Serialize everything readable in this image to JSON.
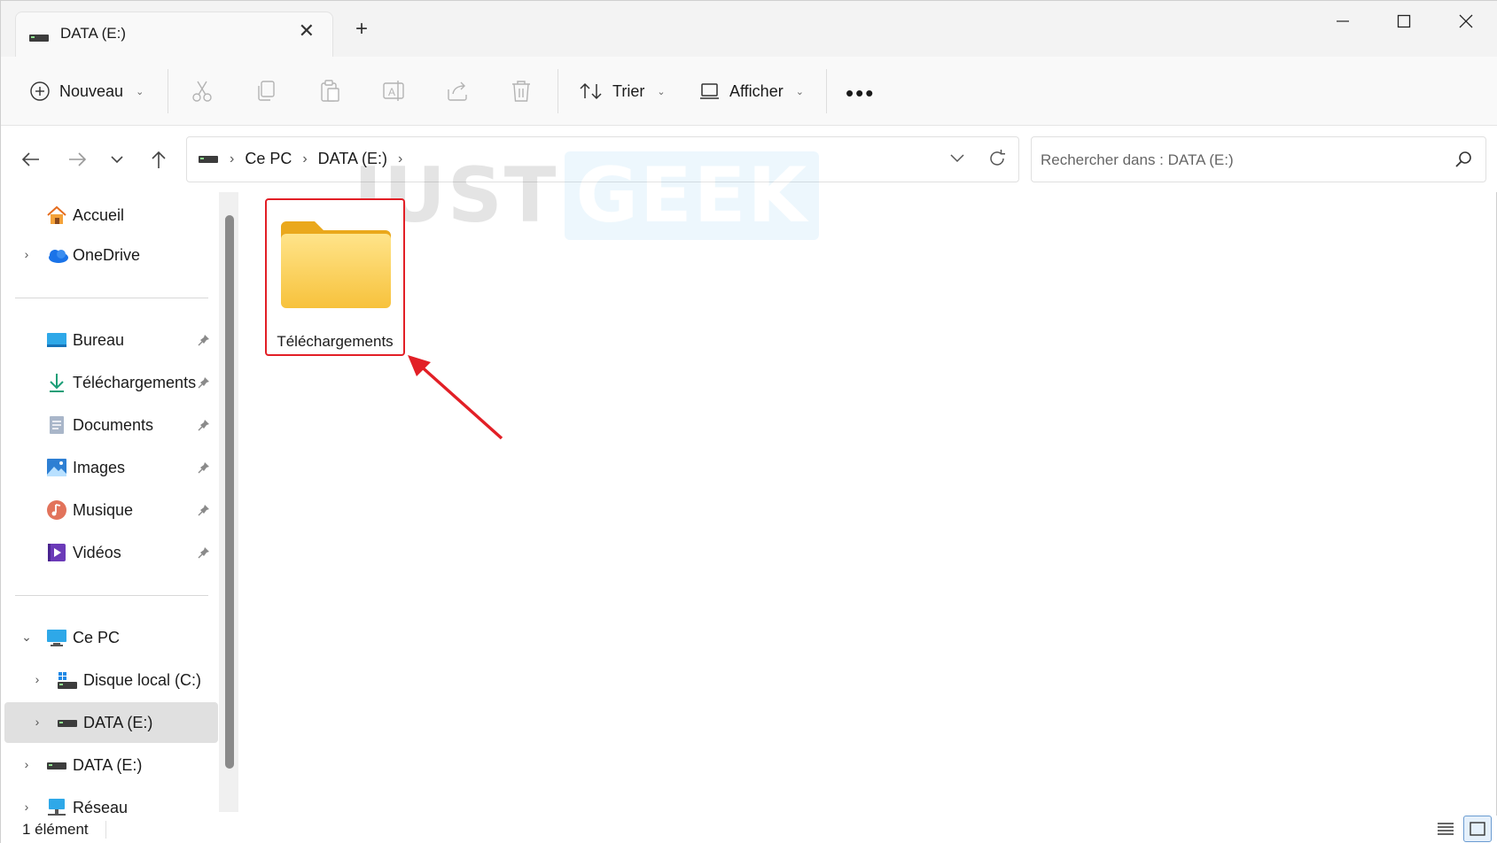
{
  "tab": {
    "title": "DATA (E:)",
    "close_glyph": "✕",
    "new_glyph": "+"
  },
  "window_controls": {
    "minimize": "minimize-icon",
    "maximize": "maximize-icon",
    "close": "close-icon"
  },
  "toolbar": {
    "new_label": "Nouveau",
    "sort_label": "Trier",
    "view_label": "Afficher",
    "more_label": "•••",
    "icons": [
      "cut-icon",
      "copy-icon",
      "paste-icon",
      "rename-icon",
      "share-icon",
      "delete-icon"
    ]
  },
  "address": {
    "crumbs": [
      "Ce PC",
      "DATA (E:)"
    ],
    "separator": "›"
  },
  "search": {
    "placeholder": "Rechercher dans : DATA (E:)"
  },
  "sidebar": {
    "quick": [
      {
        "label": "Accueil",
        "icon": "home-icon"
      },
      {
        "label": "OneDrive",
        "icon": "onedrive-icon"
      }
    ],
    "pinned": [
      {
        "label": "Bureau",
        "icon": "desktop-icon"
      },
      {
        "label": "Téléchargements",
        "icon": "downloads-icon"
      },
      {
        "label": "Documents",
        "icon": "documents-icon"
      },
      {
        "label": "Images",
        "icon": "pictures-icon"
      },
      {
        "label": "Musique",
        "icon": "music-icon"
      },
      {
        "label": "Vidéos",
        "icon": "videos-icon"
      }
    ],
    "this_pc": {
      "label": "Ce PC",
      "icon": "computer-icon"
    },
    "drives": [
      {
        "label": "Disque local (C:)",
        "icon": "local-disk-icon"
      },
      {
        "label": "DATA (E:)",
        "icon": "drive-icon",
        "selected": true
      }
    ],
    "extra": [
      {
        "label": "DATA (E:)",
        "icon": "drive-icon"
      },
      {
        "label": "Réseau",
        "icon": "network-icon"
      }
    ]
  },
  "content": {
    "watermark": {
      "part1": "JUST",
      "part2": "GEEK"
    },
    "items": [
      {
        "name": "Téléchargements",
        "icon": "folder-icon"
      }
    ]
  },
  "status": {
    "count": "1 élément"
  },
  "colors": {
    "highlight": "#e21f26",
    "selection": "#e0e0e0",
    "folder": "#f8c846"
  }
}
